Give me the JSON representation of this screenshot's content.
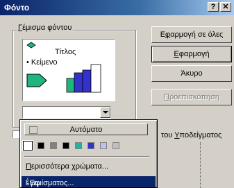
{
  "window": {
    "title": "Φόντο"
  },
  "titlebar_buttons": {
    "help": "?",
    "close": "✕"
  },
  "group": {
    "label_ul": "Γ",
    "label_rest": "έμισμα φόντου"
  },
  "preview": {
    "title": "Τίτλος",
    "bullet": "• Κείμενο"
  },
  "buttons": {
    "apply_all_pre": "Ε",
    "apply_all_ul": "φ",
    "apply_all_post": "αρμογή σε όλες",
    "apply_ul": "Ε",
    "apply_rest": "φαρμογή",
    "cancel": "Άκυρο",
    "preview_ul": "Π",
    "preview_rest": "ροεπισκόπηση"
  },
  "checkbox": {
    "label_pre": "του ",
    "label_ul": "Υ",
    "label_post": "ποδείγματος"
  },
  "popup": {
    "automatic": "Αυτόματο",
    "swatches": [
      "#ffffff",
      "#000000",
      "#808080",
      "#000000",
      "#1fb5a0",
      "#3333cc",
      "#c0c0f0",
      "#c0c0c0"
    ],
    "more_ul": "Π",
    "more_rest": "ερισσότερα χρώματα...",
    "fill_pre": "Εφ",
    "fill_ul": "έ",
    "fill_post": " γεμίσματος..."
  },
  "colors": {
    "titlebar_start": "#0a246a",
    "titlebar_end": "#a6caf0",
    "dialog_face": "#d4d0c8",
    "preview_accent": "#1fb57e",
    "chart_blue": "#3333cc"
  }
}
